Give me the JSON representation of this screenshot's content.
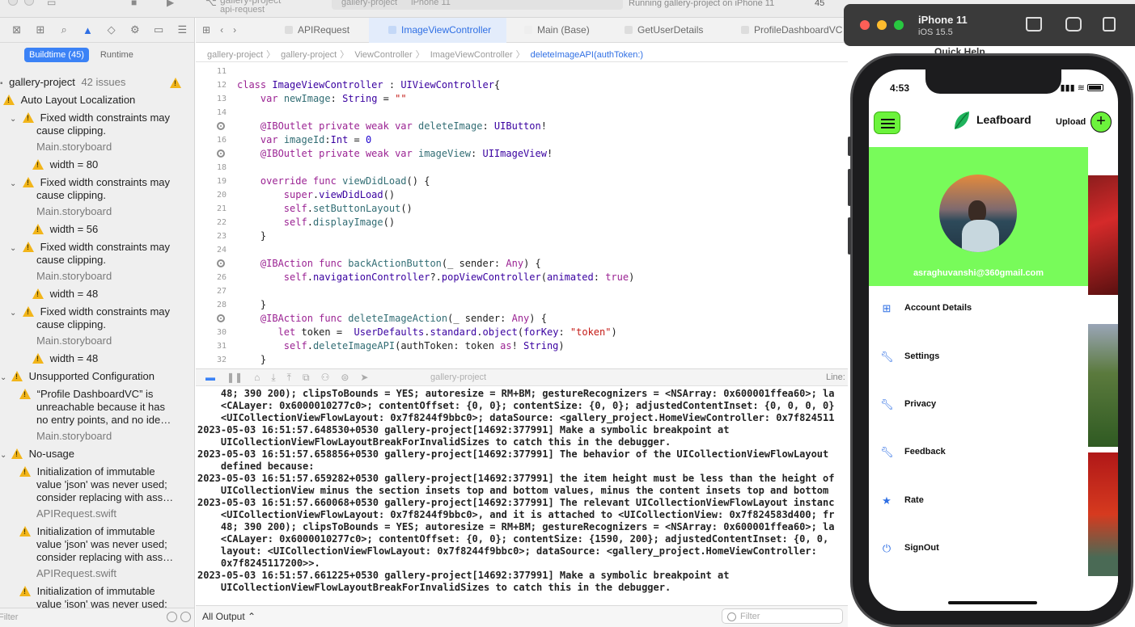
{
  "topbar": {
    "project_name": "gallery-project",
    "scheme": "api-request",
    "destination_scheme": "gallery-project",
    "destination_device": "iPhone 11",
    "status": "Running gallery-project on iPhone 11",
    "issue_count": "45"
  },
  "navigator": {
    "tabs": [
      "Buildtime (45)",
      "Runtime"
    ],
    "active_tab": "Buildtime (45)",
    "project": {
      "name": "gallery-project",
      "count": "42 issues"
    },
    "groups": [
      {
        "label": "Auto Layout Localization"
      },
      {
        "label": "Unsupported Configuration"
      },
      {
        "label": "No-usage"
      }
    ],
    "issues": [
      {
        "line1": "Fixed width constraints may",
        "line2": "cause clipping.",
        "file": "Main.storyboard",
        "detail": "width = 80"
      },
      {
        "line1": "Fixed width constraints may",
        "line2": "cause clipping.",
        "file": "Main.storyboard",
        "detail": "width = 56"
      },
      {
        "line1": "Fixed width constraints may",
        "line2": "cause clipping.",
        "file": "Main.storyboard",
        "detail": "width = 48"
      },
      {
        "line1": "Fixed width constraints may",
        "line2": "cause clipping.",
        "file": "Main.storyboard",
        "detail": "width = 48"
      }
    ],
    "unsupported": {
      "line1": "“Profile DashboardVC” is",
      "line2": "unreachable because it has",
      "line3": "no entry points, and no ide…",
      "file": "Main.storyboard"
    },
    "nousage": [
      {
        "line1": "Initialization of immutable",
        "line2": "value 'json' was never used;",
        "line3": "consider replacing with ass…",
        "file": "APIRequest.swift"
      },
      {
        "line1": "Initialization of immutable",
        "line2": "value 'json' was never used;",
        "line3": "consider replacing with ass…",
        "file": "APIRequest.swift"
      },
      {
        "line1": "Initialization of immutable",
        "line2": "value 'json' was never used;"
      }
    ],
    "filter_placeholder": "Filter"
  },
  "editor": {
    "tabs": [
      "APIRequest",
      "ImageViewController",
      "Main (Base)",
      "GetUserDetails",
      "ProfileDashboardVC"
    ],
    "active_tab": "ImageViewController",
    "breadcrumb": [
      "gallery-project",
      "gallery-project",
      "ViewController",
      "ImageViewController",
      "deleteImageAPI(authToken:)"
    ],
    "line_numbers": [
      "11",
      "12",
      "13",
      "14",
      "15",
      "16",
      "17",
      "18",
      "19",
      "20",
      "21",
      "22",
      "23",
      "24",
      "25",
      "26",
      "27",
      "28",
      "29",
      "30",
      "31",
      "32"
    ],
    "debug_project": "gallery-project",
    "line_label": "Line:",
    "output_selector": "All Output ⌃",
    "console_filter_placeholder": "Filter",
    "console_lines": [
      "    48; 390 200); clipsToBounds = YES; autoresize = RM+BM; gestureRecognizers = <NSArray: 0x600001ffea60>; la",
      "    <CALayer: 0x6000010277c0>; contentOffset: {0, 0}; contentSize: {0, 0}; adjustedContentInset: {0, 0, 0, 0}",
      "    <UICollectionViewFlowLayout: 0x7f8244f9bbc0>; dataSource: <gallery_project.HomeViewController: 0x7f824511",
      "2023-05-03 16:51:57.648530+0530 gallery-project[14692:377991] Make a symbolic breakpoint at",
      "    UICollectionViewFlowLayoutBreakForInvalidSizes to catch this in the debugger.",
      "2023-05-03 16:51:57.658856+0530 gallery-project[14692:377991] The behavior of the UICollectionViewFlowLayout",
      "    defined because:",
      "2023-05-03 16:51:57.659282+0530 gallery-project[14692:377991] the item height must be less than the height of",
      "    UICollectionView minus the section insets top and bottom values, minus the content insets top and bottom",
      "2023-05-03 16:51:57.660068+0530 gallery-project[14692:377991] The relevant UICollectionViewFlowLayout instanc",
      "    <UICollectionViewFlowLayout: 0x7f8244f9bbc0>, and it is attached to <UICollectionView: 0x7f824583d400; fr",
      "    48; 390 200); clipsToBounds = YES; autoresize = RM+BM; gestureRecognizers = <NSArray: 0x600001ffea60>; la",
      "    <CALayer: 0x6000010277c0>; contentOffset: {0, 0}; contentSize: {1590, 200}; adjustedContentInset: {0, 0,",
      "    layout: <UICollectionViewFlowLayout: 0x7f8244f9bbc0>; dataSource: <gallery_project.HomeViewController:",
      "    0x7f8245117200>>.",
      "2023-05-03 16:51:57.661225+0530 gallery-project[14692:377991] Make a symbolic breakpoint at",
      "    UICollectionViewFlowLayoutBreakForInvalidSizes to catch this in the debugger."
    ]
  },
  "simulator": {
    "device": "iPhone 11",
    "os": "iOS 15.5",
    "time": "4:53",
    "quick_help": "Quick Help",
    "app": {
      "brand": "Leafboard",
      "upload_label": "Upload",
      "email": "asraghuvanshi@360gmail.com",
      "menu": [
        {
          "label": "Account Details",
          "icon": "grid-icon"
        },
        {
          "label": "Settings",
          "icon": "wrench-icon"
        },
        {
          "label": "Privacy",
          "icon": "wrench-icon"
        },
        {
          "label": "Feedback",
          "icon": "wrench-icon"
        },
        {
          "label": "Rate",
          "icon": "star-icon"
        },
        {
          "label": "SignOut",
          "icon": "power-icon"
        }
      ]
    }
  },
  "colors": {
    "accent": "#3b82f6",
    "drawer_header": "#78fb5a",
    "warning": "#f2b51a",
    "keyword": "#9b2393",
    "string": "#c41a16"
  }
}
